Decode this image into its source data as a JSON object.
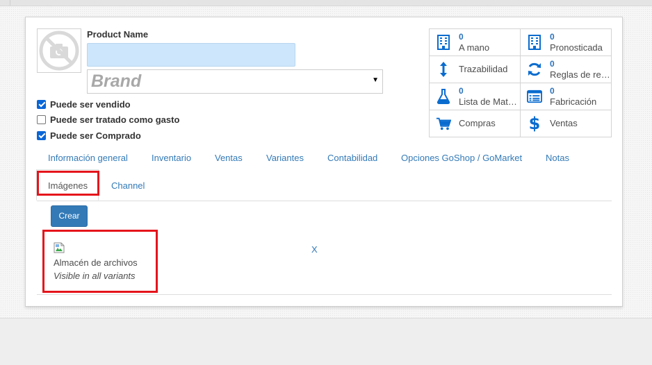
{
  "product": {
    "name_label": "Product Name",
    "name_value": "",
    "brand_placeholder": "Brand"
  },
  "checkboxes": [
    {
      "label": "Puede ser vendido",
      "checked": true
    },
    {
      "label": "Puede ser tratado como gasto",
      "checked": false
    },
    {
      "label": "Puede ser Comprado",
      "checked": true
    }
  ],
  "smart_buttons": [
    {
      "icon": "building-icon",
      "count": "0",
      "label": "A mano"
    },
    {
      "icon": "building-icon",
      "count": "0",
      "label": "Pronosticada"
    },
    {
      "icon": "vertical-arrows-icon",
      "count": "",
      "label": "Trazabilidad"
    },
    {
      "icon": "refresh-icon",
      "count": "0",
      "label": "Reglas de re…"
    },
    {
      "icon": "flask-icon",
      "count": "0",
      "label": "Lista de Mat…"
    },
    {
      "icon": "list-alt-icon",
      "count": "0",
      "label": "Fabricación"
    },
    {
      "icon": "cart-icon",
      "count": "",
      "label": "Compras"
    },
    {
      "icon": "dollar-icon",
      "count": "",
      "label": "Ventas"
    }
  ],
  "tabs": [
    {
      "label": "Información general",
      "active": false
    },
    {
      "label": "Inventario",
      "active": false
    },
    {
      "label": "Ventas",
      "active": false
    },
    {
      "label": "Variantes",
      "active": false
    },
    {
      "label": "Contabilidad",
      "active": false
    },
    {
      "label": "Opciones GoShop / GoMarket",
      "active": false
    },
    {
      "label": "Notas",
      "active": false
    },
    {
      "label": "Imágenes",
      "active": true
    },
    {
      "label": "Channel",
      "active": false
    }
  ],
  "images_tab": {
    "create_label": "Crear",
    "items": [
      {
        "title": "Almacén de archivos",
        "subtitle": "Visible in all variants",
        "remove_label": "X"
      }
    ]
  },
  "colors": {
    "accent": "#337ab7",
    "icon": "#0a6ccf",
    "highlight": "#e5141b",
    "input_bg": "#cde6fb"
  }
}
